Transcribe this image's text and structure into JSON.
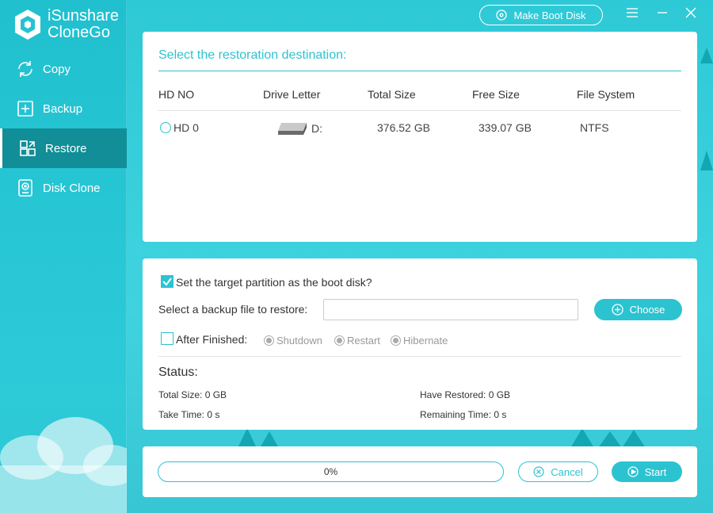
{
  "app": {
    "name_line1": "iSunshare",
    "name_line2": "CloneGo"
  },
  "sidebar": {
    "items": [
      {
        "label": "Copy",
        "icon": "refresh-icon",
        "active": false
      },
      {
        "label": "Backup",
        "icon": "plus-square-icon",
        "active": false
      },
      {
        "label": "Restore",
        "icon": "restore-grid-icon",
        "active": true
      },
      {
        "label": "Disk Clone",
        "icon": "disk-icon",
        "active": false
      }
    ]
  },
  "titlebar": {
    "make_boot_label": "Make Boot Disk"
  },
  "destination": {
    "title": "Select the restoration destination:",
    "columns": [
      "HD NO",
      "Drive Letter",
      "Total Size",
      "Free Size",
      "File System"
    ],
    "rows": [
      {
        "hd_no": "HD 0",
        "drive_letter": "D:",
        "total_size": "376.52 GB",
        "free_size": "339.07 GB",
        "file_system": "NTFS"
      }
    ]
  },
  "options": {
    "boot_disk_label": "Set the target partition as the boot disk?",
    "boot_disk_checked": true,
    "backup_file_label": "Select a backup file to restore:",
    "backup_file_value": "",
    "choose_label": "Choose",
    "after_finished_label": "After Finished:",
    "after_finished_checked": false,
    "after_options": [
      "Shutdown",
      "Restart",
      "Hibernate"
    ]
  },
  "status": {
    "heading": "Status:",
    "total_size": "Total Size: 0 GB",
    "have_restored": "Have Restored: 0 GB",
    "take_time": "Take Time: 0 s",
    "remaining_time": "Remaining Time: 0 s"
  },
  "progress": {
    "percent_text": "0%",
    "value": 0
  },
  "actions": {
    "cancel_label": "Cancel",
    "start_label": "Start"
  },
  "colors": {
    "accent": "#2cc3d0",
    "sidebar_active": "#118e97"
  }
}
